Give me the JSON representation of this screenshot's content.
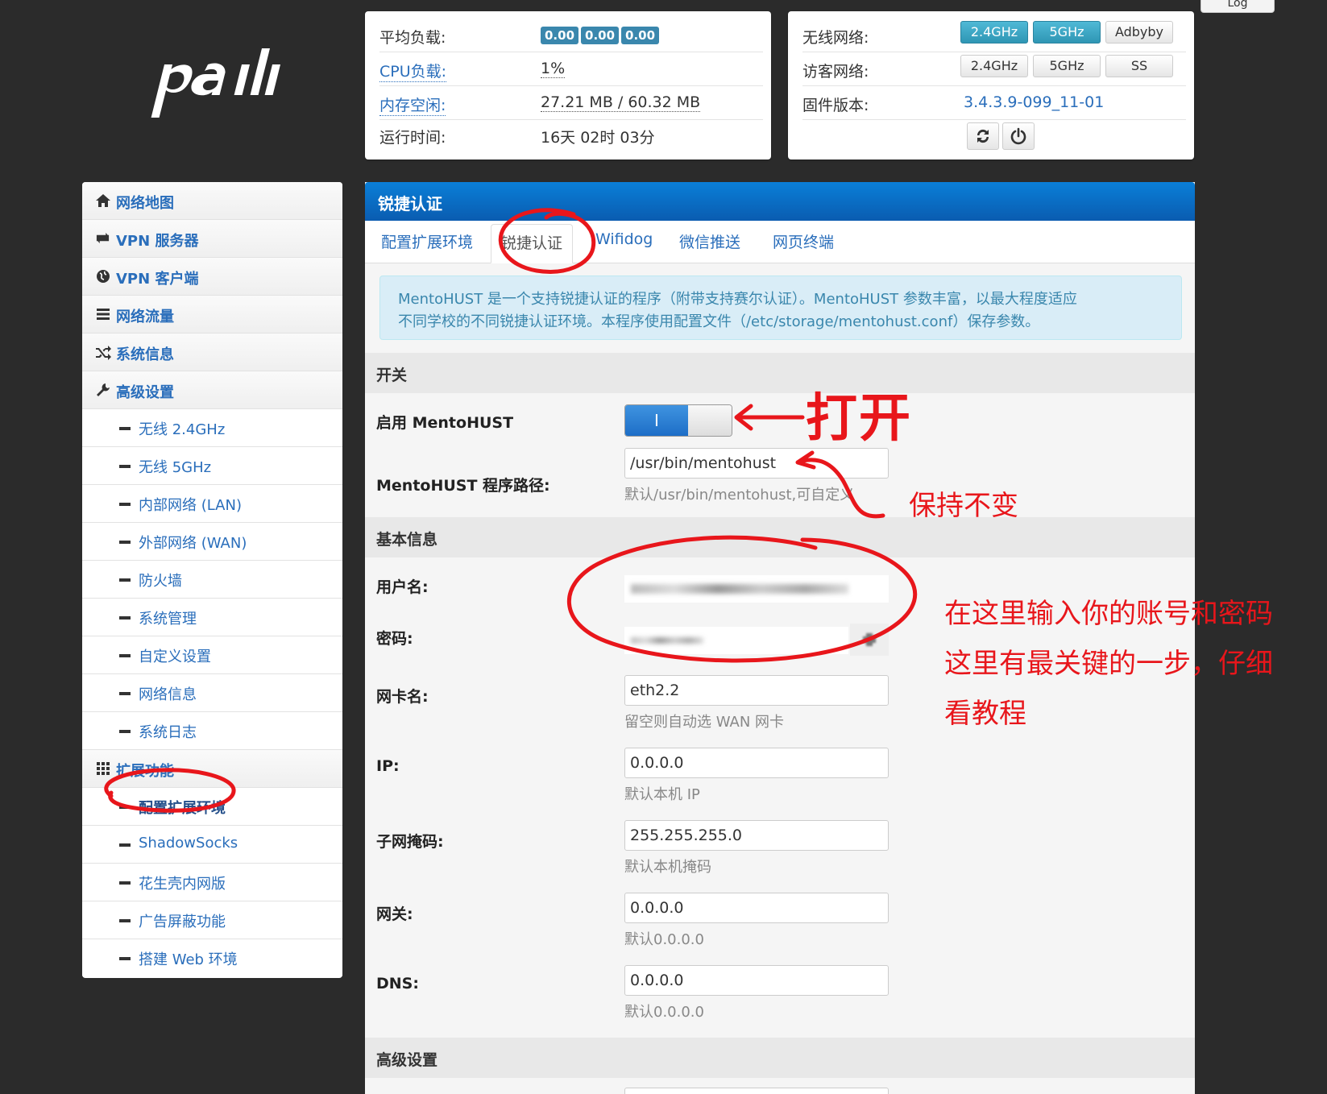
{
  "top": {
    "log_label": "Log"
  },
  "status": {
    "load_label": "平均负载:",
    "load_values": [
      "0.00",
      "0.00",
      "0.00"
    ],
    "cpu_label": "CPU负载:",
    "cpu_value": "1%",
    "mem_label": "内存空闲:",
    "mem_value": "27.21 MB / 60.32 MB",
    "uptime_label": "运行时间:",
    "uptime_value": "16天 02时 03分"
  },
  "wifi": {
    "wireless_label": "无线网络:",
    "wireless_buttons": [
      "2.4GHz",
      "5GHz",
      "Adbyby"
    ],
    "guest_label": "访客网络:",
    "guest_buttons": [
      "2.4GHz",
      "5GHz",
      "SS"
    ],
    "firmware_label": "固件版本:",
    "firmware_value": "3.4.3.9-099_11-01",
    "refresh_icon": "refresh-icon",
    "power_icon": "power-icon"
  },
  "sidebar": {
    "items": [
      {
        "label": "网络地图",
        "icon": "home-icon"
      },
      {
        "label": "VPN 服务器",
        "icon": "retweet-icon"
      },
      {
        "label": "VPN 客户端",
        "icon": "globe-icon"
      },
      {
        "label": "网络流量",
        "icon": "list-icon"
      },
      {
        "label": "系统信息",
        "icon": "shuffle-icon"
      },
      {
        "label": "高级设置",
        "icon": "wrench-icon"
      }
    ],
    "advanced": [
      "无线 2.4GHz",
      "无线 5GHz",
      "内部网络 (LAN)",
      "外部网络 (WAN)",
      "防火墙",
      "系统管理",
      "自定义设置",
      "网络信息",
      "系统日志"
    ],
    "ext_label": "扩展功能",
    "ext_icon": "grid-icon",
    "ext_items": [
      "配置扩展环境",
      "ShadowSocks",
      "花生壳内网版",
      "广告屏蔽功能",
      "搭建 Web 环境"
    ]
  },
  "main": {
    "title": "锐捷认证",
    "tabs": [
      "配置扩展环境",
      "锐捷认证",
      "Wifidog",
      "微信推送",
      "网页终端"
    ],
    "info_line1": "MentoHUST 是一个支持锐捷认证的程序（附带支持赛尔认证）。MentoHUST 参数丰富，以最大程度适应",
    "info_line2": "不同学校的不同锐捷认证环境。本程序使用配置文件（/etc/storage/mentohust.conf）保存参数。",
    "section_switch": "开关",
    "enable_label": "启用 MentoHUST",
    "toggle_on_label": "I",
    "path_label": "MentoHUST 程序路径:",
    "path_value": "/usr/bin/mentohust",
    "path_hint": "默认/usr/bin/mentohust,可自定义",
    "section_basic": "基本信息",
    "user_label": "用户名:",
    "pass_label": "密码:",
    "nic_label": "网卡名:",
    "nic_value": "eth2.2",
    "nic_hint": "留空则自动选 WAN 网卡",
    "ip_label": "IP:",
    "ip_value": "0.0.0.0",
    "ip_hint": "默认本机 IP",
    "mask_label": "子网掩码:",
    "mask_value": "255.255.255.0",
    "mask_hint": "默认本机掩码",
    "gw_label": "网关:",
    "gw_value": "0.0.0.0",
    "gw_hint": "默认0.0.0.0",
    "dns_label": "DNS:",
    "dns_value": "0.0.0.0",
    "dns_hint": "默认0.0.0.0",
    "section_adv": "高级设置"
  },
  "annotations": {
    "open": "打开",
    "keep": "保持不变",
    "line1": "在这里输入你的账号和密码",
    "line2": "这里有最关键的一步，仔细",
    "line3": "看教程"
  },
  "colors": {
    "accent": "#2a6ebb",
    "header_blue": "#0a6bc4",
    "badge": "#3a87ad",
    "annotation": "#e8161b"
  }
}
